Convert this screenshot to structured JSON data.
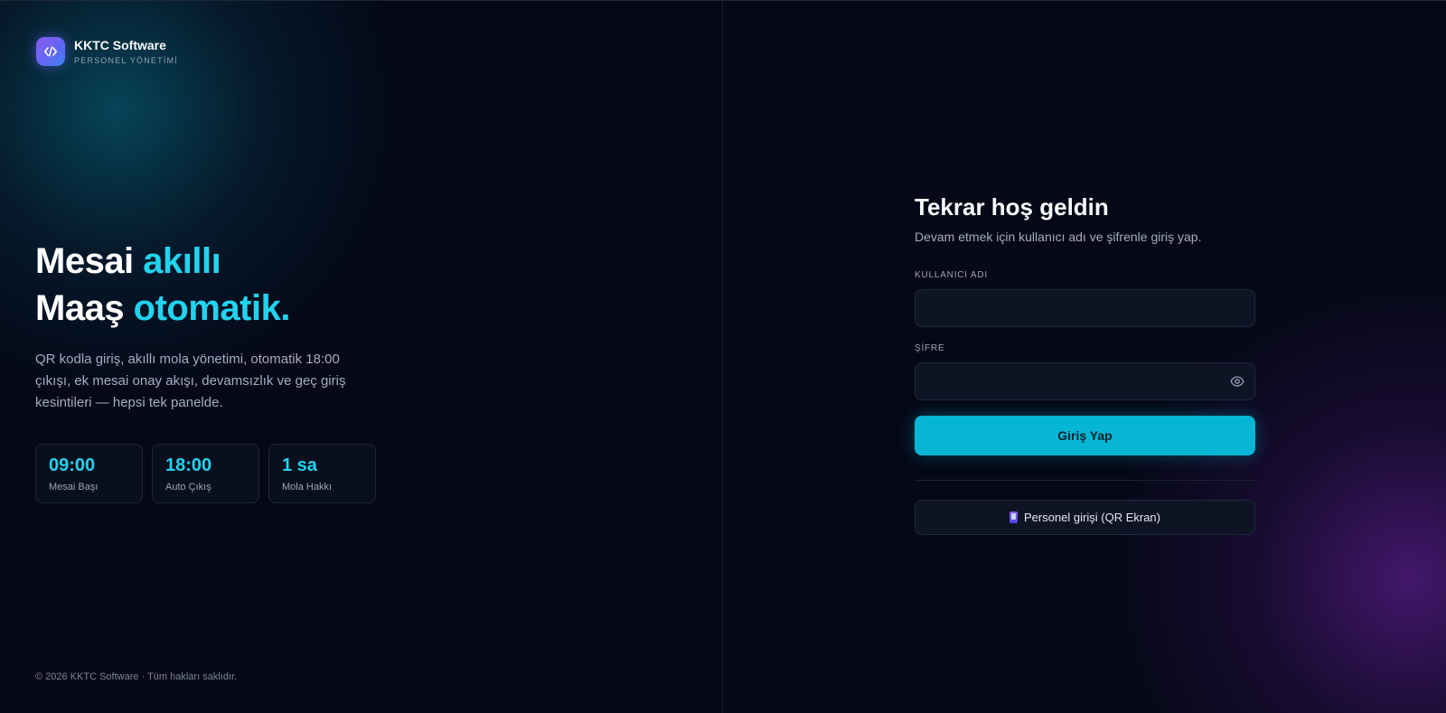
{
  "brand": {
    "name": "KKTC Software",
    "subtitle": "PERSONEL YÖNETİMİ",
    "logo_icon": "code-icon"
  },
  "hero": {
    "line1_plain": "Mesai ",
    "line1_accent": "akıllı",
    "line2_plain": "Maaş ",
    "line2_accent": "otomatik.",
    "description": "QR kodla giriş, akıllı mola yönetimi, otomatik 18:00 çıkışı, ek mesai onay akışı, devamsızlık ve geç giriş kesintileri — hepsi tek panelde."
  },
  "stats": [
    {
      "value": "09:00",
      "label": "Mesai Başı"
    },
    {
      "value": "18:00",
      "label": "Auto Çıkış"
    },
    {
      "value": "1 sa",
      "label": "Mola Hakkı"
    }
  ],
  "footer": {
    "copyright": "© 2026 KKTC Software · Tüm hakları saklıdır."
  },
  "login": {
    "title": "Tekrar hoş geldin",
    "subtitle": "Devam etmek için kullanıcı adı ve şifrenle giriş yap.",
    "username_label": "KULLANICI ADI",
    "username_value": "",
    "password_label": "ŞİFRE",
    "password_value": "",
    "password_toggle_icon": "eye-icon",
    "submit_label": "Giriş Yap",
    "qr_label": "Personel girişi (QR Ekran)",
    "qr_icon": "phone-icon"
  },
  "colors": {
    "background": "#050816",
    "accent": "#22d3ee",
    "primary_button": "#06b6d4",
    "brand_gradient_start": "#8b5cf6",
    "brand_gradient_end": "#3b82f6",
    "glow_left": "#08586e",
    "glow_right": "#581c87"
  }
}
